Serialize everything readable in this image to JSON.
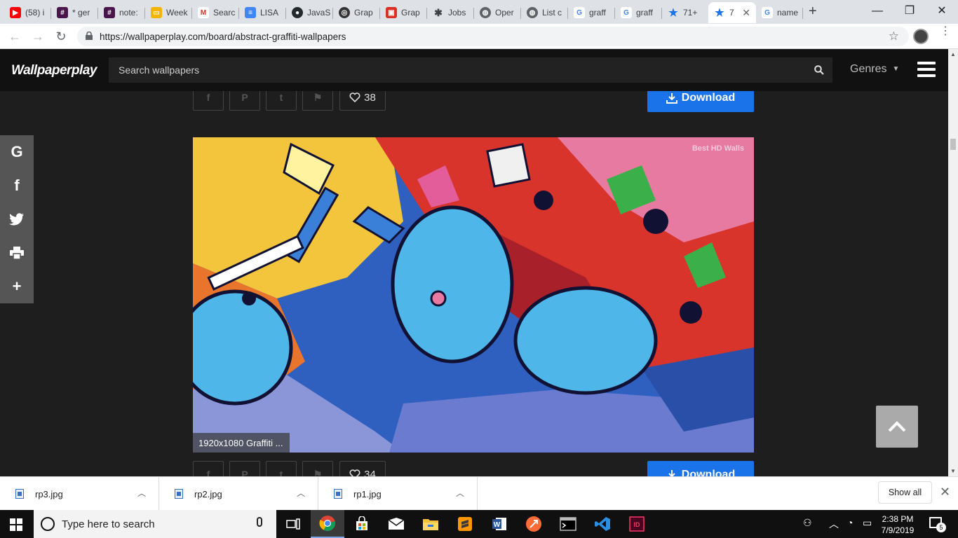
{
  "browser": {
    "tabs": [
      {
        "title": "(58) i",
        "icon": "youtube-icon",
        "color": "#ff0000",
        "glyph": "▶"
      },
      {
        "title": "* ger",
        "icon": "slack-icon",
        "color": "#4a154b",
        "glyph": "#"
      },
      {
        "title": "note:",
        "icon": "slack-icon",
        "color": "#4a154b",
        "glyph": "#"
      },
      {
        "title": "Week",
        "icon": "slides-icon",
        "color": "#f4b400",
        "glyph": "▭"
      },
      {
        "title": "Searc",
        "icon": "gmail-icon",
        "color": "#d93025",
        "glyph": "M"
      },
      {
        "title": "LISA",
        "icon": "docs-icon",
        "color": "#4285f4",
        "glyph": "≡"
      },
      {
        "title": "JavaS",
        "icon": "github-icon",
        "color": "#24292e",
        "glyph": "●"
      },
      {
        "title": "Grap",
        "icon": "logo-icon",
        "color": "#333333",
        "glyph": "◎"
      },
      {
        "title": "Grap",
        "icon": "bookmark-icon",
        "color": "#d93025",
        "glyph": "▣"
      },
      {
        "title": "Jobs",
        "icon": "star-icon",
        "color": "#3c4043",
        "glyph": "✱"
      },
      {
        "title": "Oper",
        "icon": "globe-icon",
        "color": "#5f6368",
        "glyph": "◍"
      },
      {
        "title": "List c",
        "icon": "globe-icon",
        "color": "#5f6368",
        "glyph": "◍"
      },
      {
        "title": "graff",
        "icon": "google-icon",
        "color": "#4285f4",
        "glyph": "G"
      },
      {
        "title": "graff",
        "icon": "google-icon",
        "color": "#4285f4",
        "glyph": "G"
      },
      {
        "title": "71+",
        "icon": "star-icon",
        "color": "#1a73e8",
        "glyph": "★"
      },
      {
        "title": "7",
        "icon": "star-icon",
        "color": "#1a73e8",
        "glyph": "★",
        "active": true
      },
      {
        "title": "name",
        "icon": "google-icon",
        "color": "#4285f4",
        "glyph": "G"
      }
    ],
    "url": "https://wallpaperplay.com/board/abstract-graffiti-wallpapers"
  },
  "site": {
    "logo": "Wallpaperplay",
    "search_placeholder": "Search wallpapers",
    "genres_label": "Genres"
  },
  "wallpaper_top": {
    "likes": "38",
    "download_label": "Download"
  },
  "wallpaper_main": {
    "caption": "1920x1080 Graffiti ...",
    "watermark": "Best HD Walls"
  },
  "wallpaper_next": {
    "likes": "34",
    "download_label": "Download"
  },
  "share_icons": [
    "google-icon",
    "facebook-icon",
    "twitter-icon",
    "print-icon",
    "plus-icon"
  ],
  "downloads": [
    {
      "name": "rp3.jpg"
    },
    {
      "name": "rp2.jpg"
    },
    {
      "name": "rp1.jpg"
    }
  ],
  "shelf": {
    "show_all": "Show all"
  },
  "taskbar": {
    "search_placeholder": "Type here to search",
    "time": "2:38 PM",
    "date": "7/9/2019",
    "notification_count": "5"
  },
  "colors": {
    "accent": "#1a73e8",
    "site_bg": "#1e1e1e",
    "header_bg": "#111111"
  }
}
